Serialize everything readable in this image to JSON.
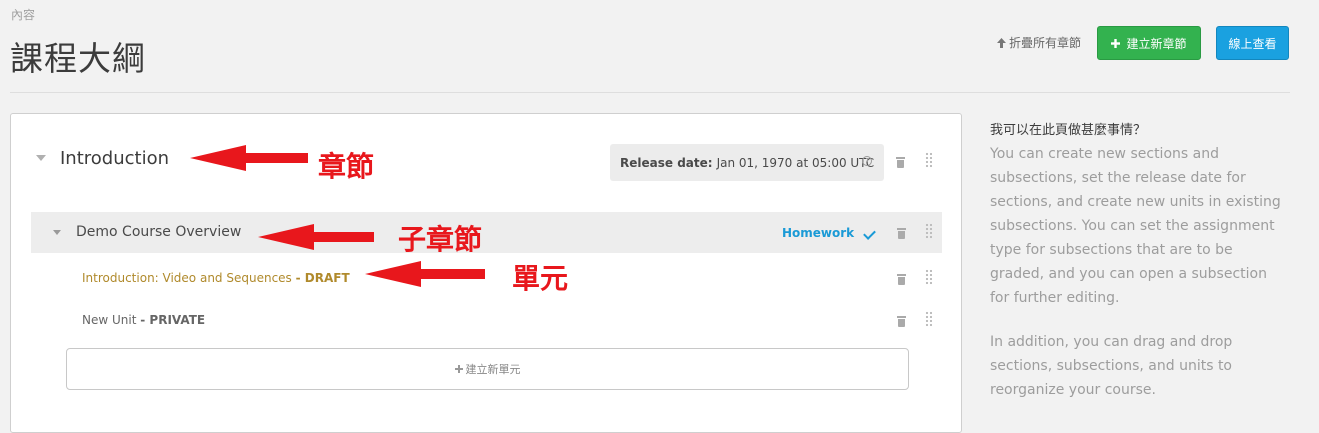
{
  "header": {
    "subtitle": "內容",
    "title": "課程大綱",
    "collapse_label": "折疊所有章節",
    "new_section_label": "建立新章節",
    "view_live_label": "線上查看"
  },
  "section": {
    "title": "Introduction",
    "release_label": "Release date:",
    "release_value": "Jan 01, 1970 at 05:00 UTC"
  },
  "subsection": {
    "title": "Demo Course Overview",
    "grading": "Homework"
  },
  "units": [
    {
      "title": "Introduction: Video and Sequences",
      "status": "- DRAFT"
    },
    {
      "title": "New Unit",
      "status": "- PRIVATE"
    }
  ],
  "new_unit_label": "建立新單元",
  "annotations": {
    "section": "章節",
    "subsection": "子章節",
    "unit": "單元"
  },
  "help": {
    "title": "我可以在此頁做甚麼事情？",
    "paragraph1": "You can create new sections and subsections, set the release date for sections, and create new units in existing subsections. You can set the assignment type for subsections that are to be graded, and you can open a subsection for further editing.",
    "paragraph2": "In addition, you can drag and drop sections, subsections, and units to reorganize your course."
  },
  "colors": {
    "accent_green": "#33b24f",
    "accent_blue": "#1aa1e0",
    "annotation_red": "#e8171c",
    "draft_gold": "#b08a2c"
  }
}
